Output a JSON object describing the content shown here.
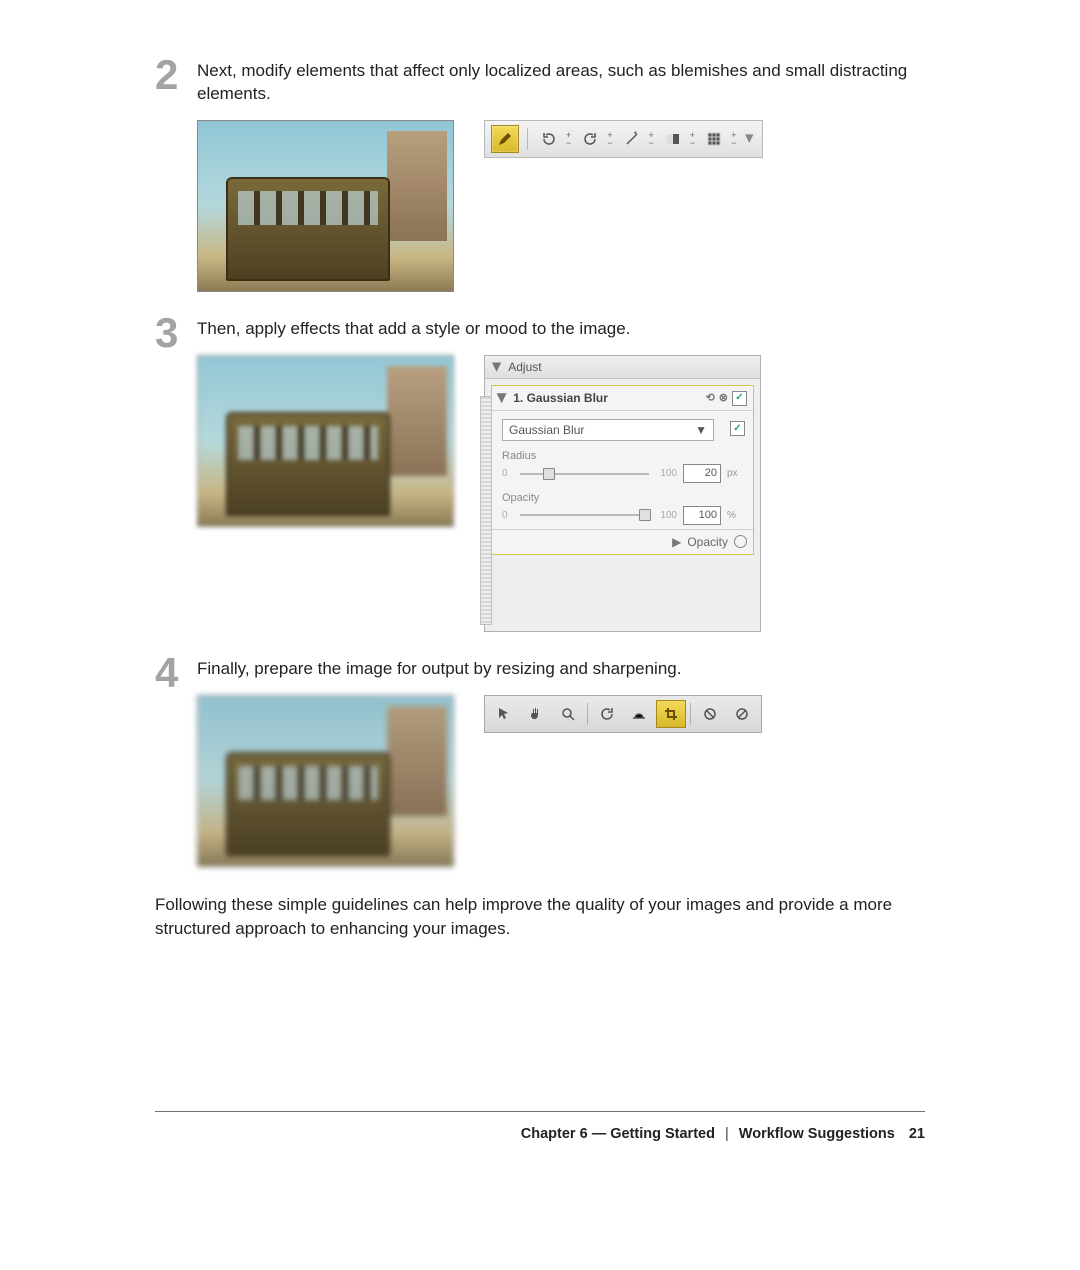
{
  "steps": {
    "s2": {
      "num": "2",
      "text": "Next, modify elements that affect only localized areas, such as blemishes and small distracting elements."
    },
    "s3": {
      "num": "3",
      "text": "Then, apply effects that add a style or mood to the image."
    },
    "s4": {
      "num": "4",
      "text": "Finally, prepare the image for output by resizing and sharpening."
    }
  },
  "closing": "Following these simple guidelines can help improve the quality of your images and provide a more structured approach to enhancing your images.",
  "adjust_panel": {
    "title": "Adjust",
    "effect_title": "1. Gaussian Blur",
    "dropdown_value": "Gaussian Blur",
    "radius": {
      "label": "Radius",
      "min": "0",
      "max": "100",
      "value": "20",
      "unit": "px",
      "pos_pct": 18
    },
    "opacity": {
      "label": "Opacity",
      "min": "0",
      "max": "100",
      "value": "100",
      "unit": "%",
      "pos_pct": 100
    },
    "footer_label": "Opacity"
  },
  "footer": {
    "chapter": "Chapter 6 — Getting Started",
    "section": "Workflow Suggestions",
    "page": "21"
  }
}
